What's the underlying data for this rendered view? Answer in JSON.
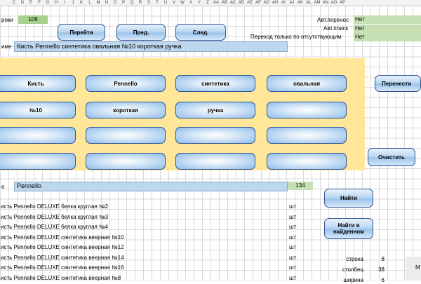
{
  "columns": [
    "C",
    "D",
    "E",
    "F",
    "G",
    "H",
    "I",
    "J",
    "K",
    "L",
    "M",
    "N",
    "O",
    "P",
    "Q",
    "R",
    "S",
    "T",
    "U",
    "V",
    "W",
    "X",
    "Y",
    "Z",
    "AA",
    "AB",
    "AC",
    "AD",
    "AE",
    "AF",
    "AG",
    "AH",
    "AI",
    "AJ",
    "AK",
    "AL",
    "AM",
    "AN",
    "AO",
    "AP"
  ],
  "top": {
    "row_label": "роки",
    "row_value": "106",
    "btn_go": "Перейти",
    "btn_prev": "Пред.",
    "btn_next": "След.",
    "auto_transfer_label": "Авт.перенос",
    "auto_transfer_value": "Нет",
    "auto_search_label": "Авт.поиск",
    "auto_search_value": "Нет",
    "absent_only_label": "Переход только по отсутствующим",
    "absent_only_value": "Нет"
  },
  "name_row": {
    "label": "име",
    "value": "Кисть Pennello синтетика овальная №10 короткая ручка"
  },
  "keywords": [
    [
      "Кисть",
      "Pennello",
      "синтетика",
      "овальная"
    ],
    [
      "№10",
      "короткая",
      "ручка",
      ""
    ],
    [
      "",
      "",
      "",
      ""
    ],
    [
      "",
      "",
      "",
      ""
    ]
  ],
  "side_buttons": {
    "transfer": "Перенести",
    "clear": "Очистить",
    "find": "Найти",
    "find_in_found": "Найти в найденном"
  },
  "search_row": {
    "label": "е",
    "value": "Pennello",
    "count": "134"
  },
  "results": [
    {
      "name": "исть Pennello DELUXE белка круглая №2",
      "unit": "шт"
    },
    {
      "name": "исть Pennello DELUXE белка круглая №3",
      "unit": "шт"
    },
    {
      "name": "исть Pennello DELUXE белка круглая №4",
      "unit": "шт"
    },
    {
      "name": "исть Pennello DELUXE синтетика веерная №10",
      "unit": "шт"
    },
    {
      "name": "исть Pennello DELUXE синтетика веерная №12",
      "unit": "шт"
    },
    {
      "name": "исть Pennello DELUXE синтетика веерная №14",
      "unit": "шт"
    },
    {
      "name": "исть Pennello DELUXE синтетика веерная №16",
      "unit": "шт"
    },
    {
      "name": "исть Pennello DELUXE синтетика веерная №8",
      "unit": "шт"
    }
  ],
  "stats": [
    {
      "label": "строка",
      "value": "8"
    },
    {
      "label": "столбец",
      "value": "38"
    },
    {
      "label": "ширина",
      "value": "6"
    }
  ],
  "corner_text": "М"
}
